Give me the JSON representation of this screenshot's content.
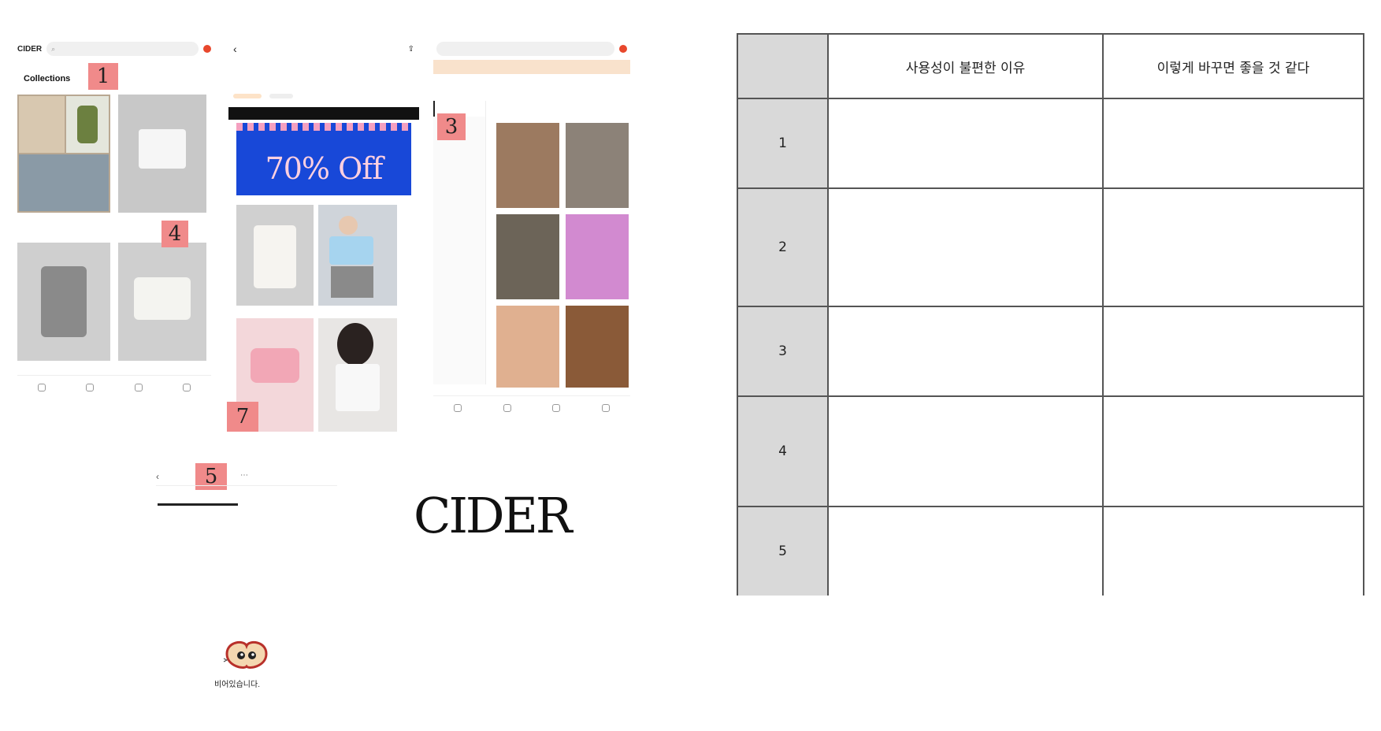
{
  "screen1": {
    "brand": "CIDER",
    "search_placeholder": "",
    "section_title": "Collections",
    "product_a": {
      "title": "",
      "meta": ""
    },
    "product_b": {
      "title": "",
      "meta": ""
    },
    "product_c": {
      "title": "",
      "meta": ""
    },
    "product_d": {
      "title": "",
      "meta": ""
    },
    "nav": [
      "",
      "",
      "",
      ""
    ]
  },
  "screen2": {
    "title": "",
    "filters": [
      "",
      "",
      "",
      ""
    ],
    "chips": [
      "",
      ""
    ],
    "promo_banner_top": "",
    "promo_small": "",
    "promo_big": "70% Off",
    "product_a": {
      "title": "",
      "meta": ""
    },
    "product_b": {
      "title": "",
      "meta": ""
    }
  },
  "screen3": {
    "search_placeholder": "",
    "notice": "",
    "categories": [
      "",
      "",
      "",
      "",
      "",
      ""
    ],
    "sidebar_items": [
      "",
      "",
      "",
      "",
      "",
      "",
      "",
      "",
      "",
      "",
      "",
      ""
    ],
    "section_title": "",
    "nav": [
      "",
      "",
      "",
      ""
    ]
  },
  "badges": [
    "1",
    "2",
    "3",
    "4",
    "5",
    "7"
  ],
  "tabs": {
    "active": "",
    "inactive": ""
  },
  "logo_text": "CIDER",
  "empty_state": {
    "text": "비어있습니다."
  },
  "table": {
    "headers": [
      "",
      "사용성이 불편한 이유",
      "이렇게 바꾸면 좋을 것 같다"
    ],
    "rows": [
      {
        "num": "1",
        "reason": "",
        "improve": ""
      },
      {
        "num": "2",
        "reason": "",
        "improve": ""
      },
      {
        "num": "3",
        "reason": "",
        "improve": ""
      },
      {
        "num": "4",
        "reason": "",
        "improve": ""
      },
      {
        "num": "5",
        "reason": "",
        "improve": ""
      }
    ]
  },
  "colors": {
    "badge": "#f08a8a",
    "promo_blue": "#1848d8",
    "table_link": "#1a2a8c",
    "accent_red": "#e8472c"
  }
}
